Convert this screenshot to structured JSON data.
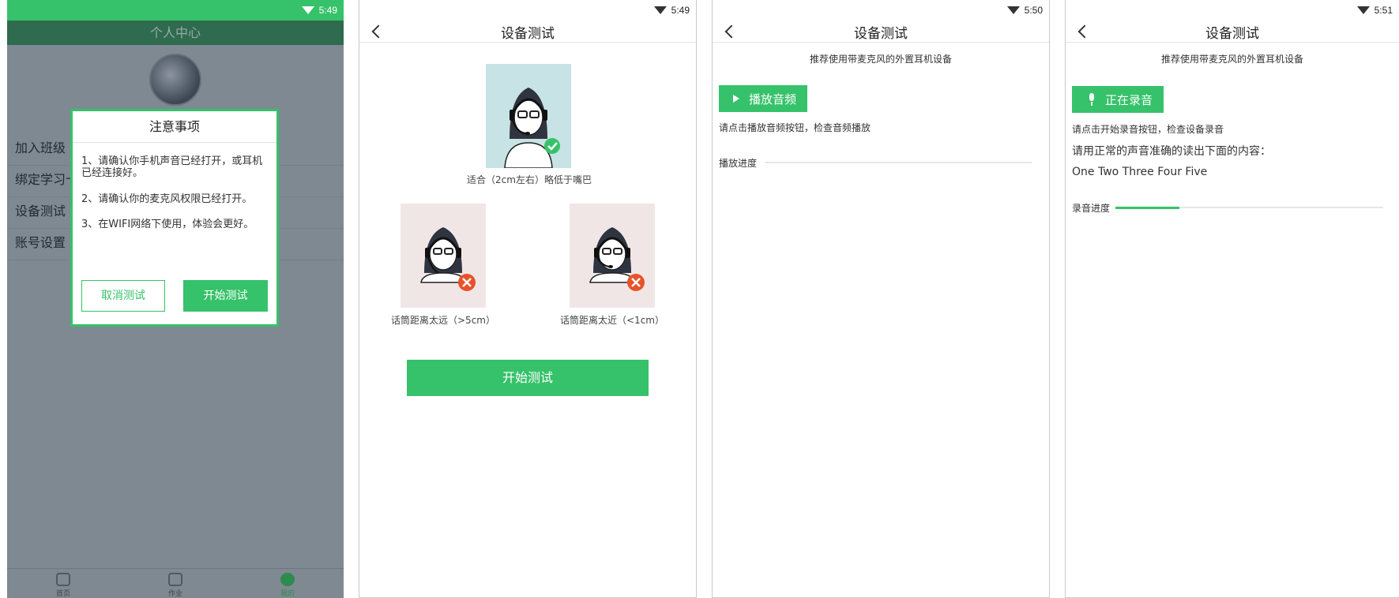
{
  "screen1": {
    "status_time": "5:49",
    "header_title": "个人中心",
    "menu": [
      "加入班级",
      "绑定学习卡",
      "设备测试",
      "账号设置"
    ],
    "dialog": {
      "title": "注意事项",
      "notes": [
        "1、请确认你手机声音已经打开，或耳机已经连接好。",
        "2、请确认你的麦克风权限已经打开。",
        "3、在WIFI网络下使用，体验会更好。"
      ],
      "cancel_label": "取消测试",
      "start_label": "开始测试"
    },
    "bottom_nav": [
      "首页",
      "作业",
      "我的"
    ]
  },
  "screen2": {
    "status_time": "5:49",
    "title": "设备测试",
    "good_caption": "适合（2cm左右）略低于嘴巴",
    "far_caption": "话筒距离太远（>5cm）",
    "near_caption": "话筒距离太近（<1cm）",
    "start_label": "开始测试"
  },
  "screen3": {
    "status_time": "5:50",
    "title": "设备测试",
    "hint": "推荐使用带麦克风的外置耳机设备",
    "play_label": "播放音频",
    "instruction": "请点击播放音频按钮，检查音频播放",
    "progress_label": "播放进度",
    "progress": 0
  },
  "screen4": {
    "status_time": "5:51",
    "title": "设备测试",
    "hint": "推荐使用带麦克风的外置耳机设备",
    "record_label": "正在录音",
    "instruction": "请点击开始录音按钮，检查设备录音",
    "read_prompt": "请用正常的声音准确的读出下面的内容：",
    "read_text": "One Two Three Four Five",
    "progress_label": "录音进度",
    "progress": 0.24
  },
  "colors": {
    "accent": "#36c26a",
    "success": "#36c26a",
    "error": "#e8522a"
  }
}
